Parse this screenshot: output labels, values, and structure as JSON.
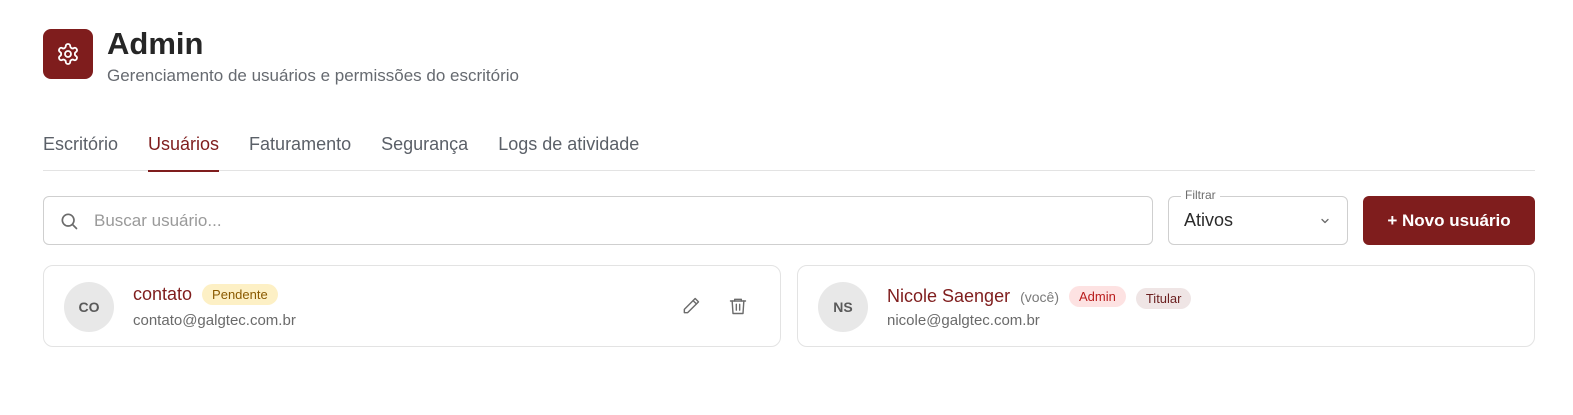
{
  "header": {
    "icon": "gear-icon",
    "title": "Admin",
    "subtitle": "Gerenciamento de usuários e permissões do escritório"
  },
  "tabs": [
    {
      "label": "Escritório",
      "active": false
    },
    {
      "label": "Usuários",
      "active": true
    },
    {
      "label": "Faturamento",
      "active": false
    },
    {
      "label": "Segurança",
      "active": false
    },
    {
      "label": "Logs de atividade",
      "active": false
    }
  ],
  "search": {
    "icon": "search-icon",
    "placeholder": "Buscar usuário...",
    "value": ""
  },
  "filter": {
    "label": "Filtrar",
    "value": "Ativos",
    "icon": "chevron-down-icon"
  },
  "new_user_button": "+ Novo usuário",
  "users": [
    {
      "initials": "CO",
      "name": "contato",
      "you_label": "",
      "badges": [
        "Pendente"
      ],
      "email": "contato@galgtec.com.br",
      "actions": [
        "pencil-icon",
        "trash-icon"
      ]
    },
    {
      "initials": "NS",
      "name": "Nicole Saenger",
      "you_label": "(você)",
      "badges": [
        "Admin",
        "Titular"
      ],
      "email": "nicole@galgtec.com.br",
      "actions": []
    }
  ],
  "colors": {
    "brand": "#7f1d1d",
    "pending_bg": "#fdf0c5",
    "admin_bg": "#fde2e2"
  }
}
